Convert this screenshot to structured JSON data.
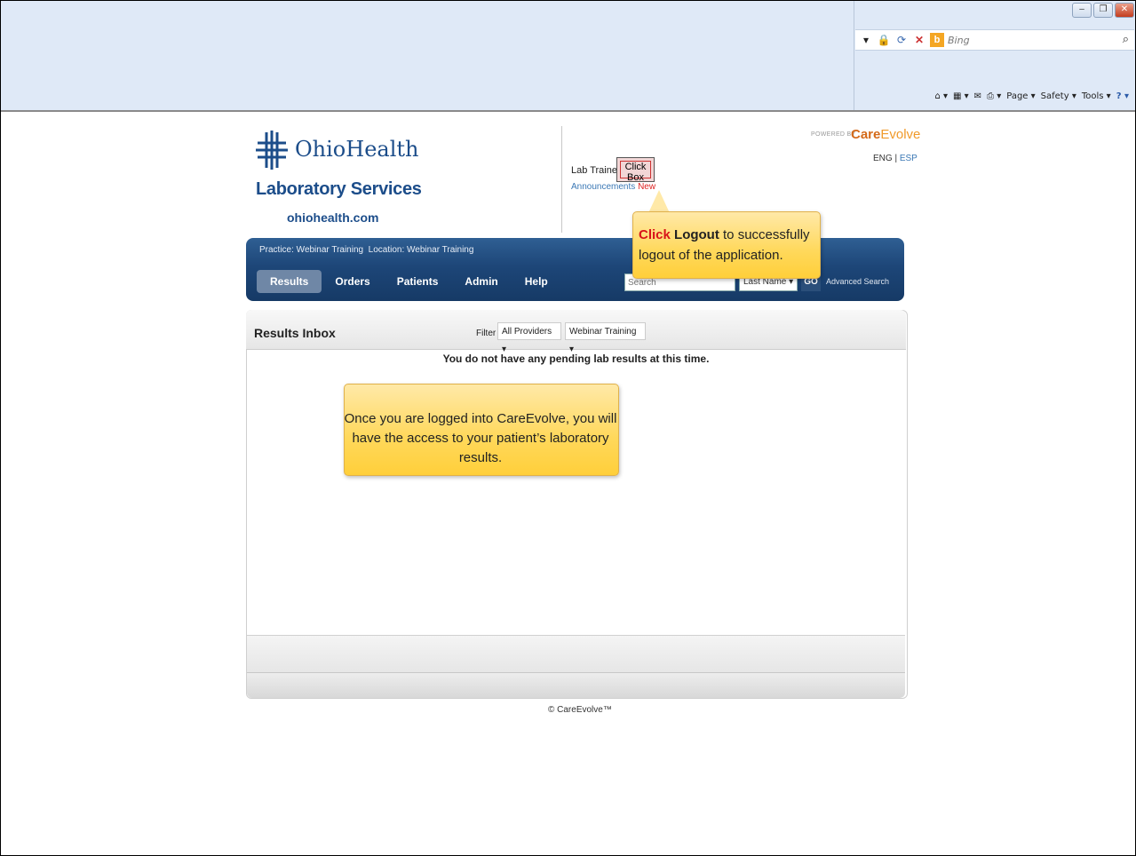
{
  "browser": {
    "search_placeholder": "Bing",
    "commands": [
      {
        "label": "Page ▾"
      },
      {
        "label": "Safety ▾"
      },
      {
        "label": "Tools ▾"
      }
    ]
  },
  "header": {
    "brand_name": "OhioHealth",
    "subtitle": "Laboratory Services",
    "url": "ohiohealth.com",
    "user_name": "Lab Trainer",
    "announcements_label": "Announcements",
    "announcements_new": "New",
    "powered_by": "POWERED BY",
    "care_logo_a": "Care",
    "care_logo_b": "Evolve",
    "lang_eng": "ENG",
    "lang_sep": "|",
    "lang_esp": "ESP"
  },
  "click_box_label": "Click Box",
  "nav": {
    "practice_text": "Practice: Webinar Training",
    "location_text": "Location: Webinar Training",
    "tabs": [
      {
        "label": "Results",
        "active": true
      },
      {
        "label": "Orders",
        "active": false
      },
      {
        "label": "Patients",
        "active": false
      },
      {
        "label": "Admin",
        "active": false
      },
      {
        "label": "Help",
        "active": false
      }
    ],
    "search_placeholder": "Search",
    "search_field_selected": "Last Name",
    "go_label": "GO",
    "advanced_search_label": "Advanced Search"
  },
  "results": {
    "title": "Results Inbox",
    "filter_label": "Filter",
    "provider_selected": "All Providers",
    "location_selected": "Webinar Training",
    "empty_message": "You do not have any pending lab results at this time."
  },
  "footer": {
    "copyright": "© CareEvolve™"
  },
  "callouts": {
    "logout_click": "Click",
    "logout_bold": "Logout",
    "logout_rest": "to successfully logout of the application.",
    "info": "Once you are logged into CareEvolve, you will have the access to your patient’s laboratory results."
  },
  "colors": {
    "brand_blue": "#1c4d8a",
    "nav_blue": "#1d4678",
    "callout_yellow": "#ffd85a",
    "alert_red": "#d8141a"
  }
}
